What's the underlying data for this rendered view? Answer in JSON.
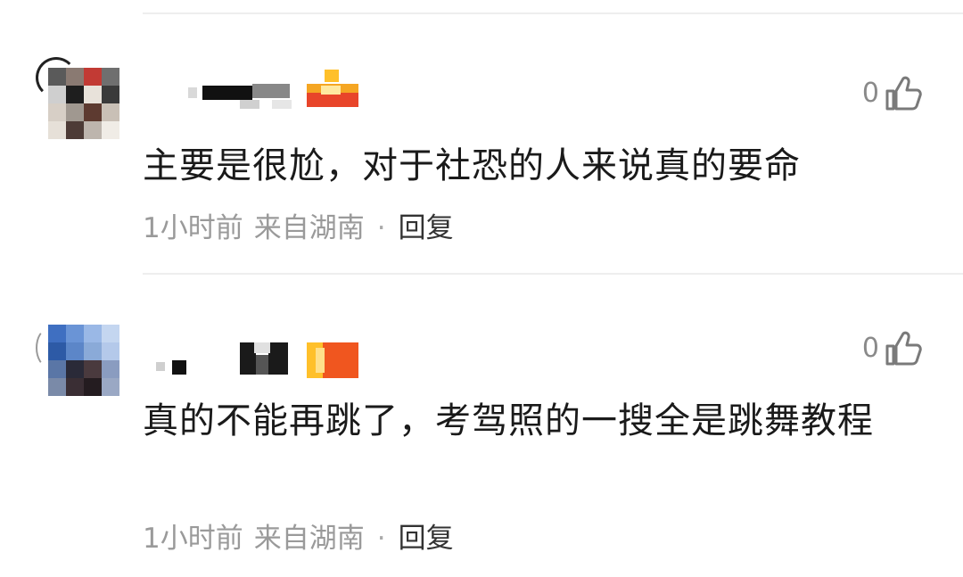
{
  "comments": [
    {
      "text": "主要是很尬，对于社恐的人来说真的要命",
      "time": "1小时前",
      "location": "来自湖南",
      "separator": "·",
      "reply_label": "回复",
      "like_count": "0",
      "like_icon": "thumbs-up-icon"
    },
    {
      "text": "真的不能再跳了，考驾照的一搜全是跳舞教程",
      "time": "1小时前",
      "location": "来自湖南",
      "separator": "·",
      "reply_label": "回复",
      "like_count": "0",
      "like_icon": "thumbs-up-icon"
    }
  ],
  "colors": {
    "text": "#1a1a1a",
    "meta": "#9a9a9a",
    "reply": "#333333",
    "divider": "#eeeeee",
    "badge_orange": "#f07a1a",
    "badge_red": "#e8452a",
    "badge_yellow": "#ffc02a"
  }
}
